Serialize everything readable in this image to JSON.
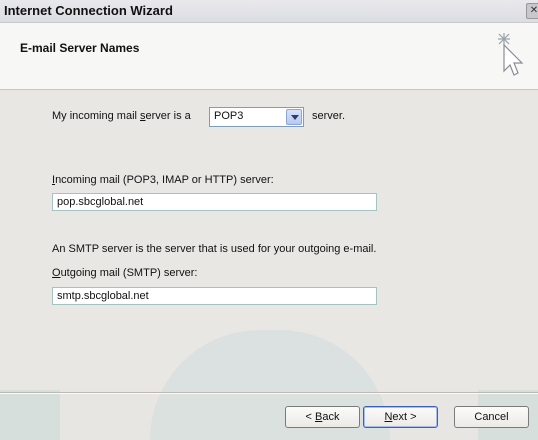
{
  "window": {
    "title": "Internet Connection Wizard"
  },
  "header": {
    "title": "E-mail Server Names",
    "icon": "wizard-cursor-sparkle-icon"
  },
  "incoming_type": {
    "label_prefix": "My incoming mail ",
    "label_underline": "s",
    "label_rest": "erver is a",
    "selected": "POP3",
    "suffix": "server."
  },
  "incoming_server": {
    "label_underline": "I",
    "label_rest": "ncoming mail (POP3, IMAP or HTTP) server:",
    "value": "pop.sbcglobal.net"
  },
  "smtp_note": "An SMTP server is the server that is used for your outgoing e-mail.",
  "outgoing_server": {
    "label_underline": "O",
    "label_rest": "utgoing mail (SMTP) server:",
    "value": "smtp.sbcglobal.net"
  },
  "buttons": {
    "back_prefix": "< ",
    "back_underline": "B",
    "back_rest": "ack",
    "next_underline": "N",
    "next_rest": "ext >",
    "cancel": "Cancel"
  }
}
